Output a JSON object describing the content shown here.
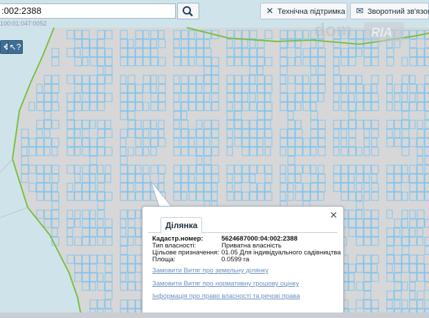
{
  "search": {
    "value": ":002:2388",
    "subtext": "100:01:047:0052"
  },
  "toolbar": {
    "support_label": "Технічна підтримка",
    "feedback_label": "Зворотний зв'язок"
  },
  "logo": {
    "text": "dom",
    "badge": "RIA"
  },
  "map_tools": [
    {
      "icon": "pan-icon"
    },
    {
      "icon": "identify-icon"
    }
  ],
  "popup": {
    "tab": "Ділянка",
    "properties": [
      {
        "key": "Кадастр.номер:",
        "value": "5624687000:04:002:2388",
        "bold": true
      },
      {
        "key": "Тип власності:",
        "value": "Приватна власність"
      },
      {
        "key": "Цільове призначення:",
        "value": "01.05 Для індивідуального садівництва"
      },
      {
        "key": "Площа:",
        "value": "0.0599 га"
      }
    ],
    "links": [
      "Замовити Витяг про земельну ділянку",
      "Замовити Витяг про нормативну грошову оцінку",
      "Інформація про право власності та речові права"
    ]
  },
  "colors": {
    "parcel_stroke": "#7fc4ef",
    "ground": "#d7d7d7",
    "water": "#cfe4ea",
    "boundary_green": "#76c043",
    "link": "#6b8fc0"
  }
}
